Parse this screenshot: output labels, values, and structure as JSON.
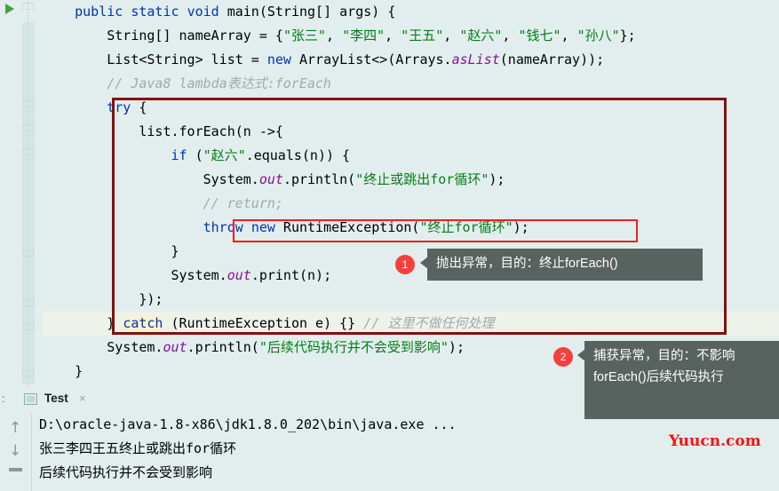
{
  "app": {
    "theme_bg": "#e1eeed",
    "accent_red": "#f2413c",
    "box_border": "#8c0b0b",
    "inner_box_border": "#f41d1d",
    "callout_bg": "#58625f"
  },
  "editor": {
    "run_arrow_icon": "run-triangle-icon",
    "lines": [
      {
        "id": "line-1",
        "tokens": [
          {
            "t": "    ",
            "c": "plain"
          },
          {
            "t": "public",
            "c": "kw"
          },
          {
            "t": " ",
            "c": "plain"
          },
          {
            "t": "static",
            "c": "kw"
          },
          {
            "t": " ",
            "c": "plain"
          },
          {
            "t": "void",
            "c": "kw"
          },
          {
            "t": " main(String[] args) {",
            "c": "plain"
          }
        ]
      },
      {
        "id": "line-2",
        "tokens": [
          {
            "t": "        String[] nameArray = {",
            "c": "plain"
          },
          {
            "t": "\"张三\"",
            "c": "str"
          },
          {
            "t": ", ",
            "c": "plain"
          },
          {
            "t": "\"李四\"",
            "c": "str"
          },
          {
            "t": ", ",
            "c": "plain"
          },
          {
            "t": "\"王五\"",
            "c": "str"
          },
          {
            "t": ", ",
            "c": "plain"
          },
          {
            "t": "\"赵六\"",
            "c": "str"
          },
          {
            "t": ", ",
            "c": "plain"
          },
          {
            "t": "\"钱七\"",
            "c": "str"
          },
          {
            "t": ", ",
            "c": "plain"
          },
          {
            "t": "\"孙八\"",
            "c": "str"
          },
          {
            "t": "};",
            "c": "plain"
          }
        ]
      },
      {
        "id": "line-3",
        "tokens": [
          {
            "t": "        List<String> list = ",
            "c": "plain"
          },
          {
            "t": "new",
            "c": "kw"
          },
          {
            "t": " ArrayList<>(Arrays.",
            "c": "plain"
          },
          {
            "t": "asList",
            "c": "fld"
          },
          {
            "t": "(nameArray));",
            "c": "plain"
          }
        ]
      },
      {
        "id": "line-4",
        "tokens": [
          {
            "t": "        // Java8 lambda表达式:forEach",
            "c": "cmt"
          }
        ]
      },
      {
        "id": "line-5",
        "tokens": [
          {
            "t": "        ",
            "c": "plain"
          },
          {
            "t": "try",
            "c": "kw"
          },
          {
            "t": " {",
            "c": "plain"
          }
        ]
      },
      {
        "id": "line-6",
        "tokens": [
          {
            "t": "            list.forEach(n ->{",
            "c": "plain"
          }
        ]
      },
      {
        "id": "line-7",
        "tokens": [
          {
            "t": "                ",
            "c": "plain"
          },
          {
            "t": "if",
            "c": "kw"
          },
          {
            "t": " (",
            "c": "plain"
          },
          {
            "t": "\"赵六\"",
            "c": "str"
          },
          {
            "t": ".equals(n)) {",
            "c": "plain"
          }
        ]
      },
      {
        "id": "line-8",
        "tokens": [
          {
            "t": "                    System.",
            "c": "plain"
          },
          {
            "t": "out",
            "c": "fld"
          },
          {
            "t": ".println(",
            "c": "plain"
          },
          {
            "t": "\"终止或跳出for循环\"",
            "c": "str"
          },
          {
            "t": ");",
            "c": "plain"
          }
        ]
      },
      {
        "id": "line-9",
        "tokens": [
          {
            "t": "                    // return;",
            "c": "cmt"
          }
        ]
      },
      {
        "id": "line-10",
        "tokens": [
          {
            "t": "                    ",
            "c": "plain"
          },
          {
            "t": "throw",
            "c": "kw"
          },
          {
            "t": " ",
            "c": "plain"
          },
          {
            "t": "new",
            "c": "kw"
          },
          {
            "t": " RuntimeException(",
            "c": "plain"
          },
          {
            "t": "\"终止for循环\"",
            "c": "str"
          },
          {
            "t": ");",
            "c": "plain"
          }
        ]
      },
      {
        "id": "line-11",
        "tokens": [
          {
            "t": "                }",
            "c": "plain"
          }
        ]
      },
      {
        "id": "line-12",
        "tokens": [
          {
            "t": "                System.",
            "c": "plain"
          },
          {
            "t": "out",
            "c": "fld"
          },
          {
            "t": ".print(n);",
            "c": "plain"
          }
        ]
      },
      {
        "id": "line-13",
        "tokens": [
          {
            "t": "            });",
            "c": "plain"
          }
        ]
      },
      {
        "id": "line-14",
        "tokens": [
          {
            "t": "        } ",
            "c": "plain"
          },
          {
            "t": "catch",
            "c": "hl-kw"
          },
          {
            "t": " (RuntimeException e) {} ",
            "c": "plain"
          },
          {
            "t": "// 这里不做任何处理",
            "c": "cmt"
          }
        ]
      },
      {
        "id": "line-15",
        "tokens": [
          {
            "t": "        System.",
            "c": "plain"
          },
          {
            "t": "out",
            "c": "fld"
          },
          {
            "t": ".println(",
            "c": "plain"
          },
          {
            "t": "\"后续代码执行并不会受到影响\"",
            "c": "str"
          },
          {
            "t": ");",
            "c": "plain"
          }
        ]
      },
      {
        "id": "line-16",
        "tokens": [
          {
            "t": "    }",
            "c": "plain"
          }
        ]
      }
    ]
  },
  "annotations": {
    "outer_box_label": "try-catch-highlight-box",
    "inner_box_label": "throw-statement-highlight-box",
    "callouts": [
      {
        "badge": "1",
        "text": "抛出异常，目的：终止forEach()"
      },
      {
        "badge": "2",
        "text": "捕获异常，目的：不影响forEach()后续代码执行"
      }
    ]
  },
  "console": {
    "tab_prefix": ":",
    "tab_label": "Test",
    "tab_close": "×",
    "icon": "console-window-icon",
    "toolbar": {
      "up_label": "↑",
      "down_label": "↓",
      "wrap_label": "soft-wrap-icon"
    },
    "output": [
      "D:\\oracle-java-1.8-x86\\jdk1.8.0_202\\bin\\java.exe ...",
      "张三李四王五终止或跳出for循环",
      "后续代码执行并不会受到影响"
    ]
  },
  "watermark": {
    "text": "Yuucn.com"
  }
}
